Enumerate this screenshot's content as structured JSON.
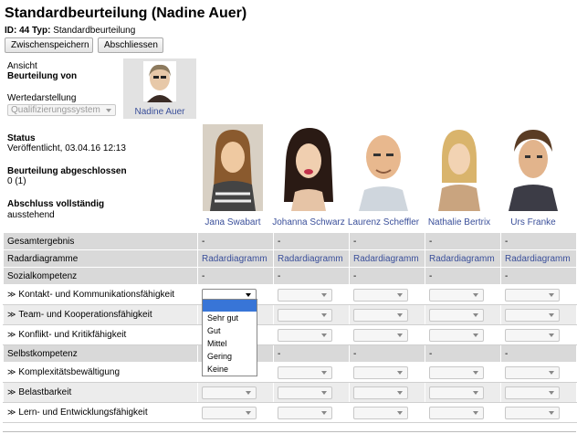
{
  "header": {
    "title": "Standardbeurteilung (Nadine Auer)",
    "id_label": "ID:",
    "id_value": "44",
    "type_label": "Typ:",
    "type_value": "Standardbeurteilung"
  },
  "toolbar": {
    "save_label": "Zwischenspeichern",
    "finish_label": "Abschliessen"
  },
  "view": {
    "label": "Ansicht",
    "evaluation_of_label": "Beurteilung von",
    "value_display_label": "Wertedarstellung",
    "value_display_selected": "Qualifizierungssystem",
    "self_name": "Nadine Auer"
  },
  "status": {
    "label": "Status",
    "value": "Veröffentlicht, 03.04.16 12:13",
    "completed_label": "Beurteilung abgeschlossen",
    "completed_value": "0 (1)",
    "full_label": "Abschluss vollständig",
    "full_value": "ausstehend"
  },
  "people": [
    {
      "name": "Jana Swabart"
    },
    {
      "name": "Johanna Schwarz"
    },
    {
      "name": "Laurenz Scheffler"
    },
    {
      "name": "Nathalie Bertrix"
    },
    {
      "name": "Urs Franke"
    }
  ],
  "table": {
    "rows": [
      {
        "label": "Gesamtergebnis",
        "cells": [
          "-",
          "-",
          "-",
          "-",
          "-"
        ]
      },
      {
        "label": "Radardiagramme",
        "link": "Radardiagramm"
      },
      {
        "label": "Sozialkompetenz",
        "cells": [
          "-",
          "-",
          "-",
          "-",
          "-"
        ]
      },
      {
        "label": "Kontakt- und Kommunikationsfähigkeit"
      },
      {
        "label": "Team- und Kooperationsfähigkeit"
      },
      {
        "label": "Konflikt- und Kritikfähigkeit"
      },
      {
        "label": "Selbstkompetenz",
        "cells": [
          "-",
          "-",
          "-",
          "-",
          "-"
        ]
      },
      {
        "label": "Komplexitätsbewältigung"
      },
      {
        "label": "Belastbarkeit"
      },
      {
        "label": "Lern- und Entwicklungsfähigkeit"
      }
    ]
  },
  "dropdown": {
    "options": [
      "Sehr gut",
      "Gut",
      "Mittel",
      "Gering",
      "Keine"
    ]
  }
}
